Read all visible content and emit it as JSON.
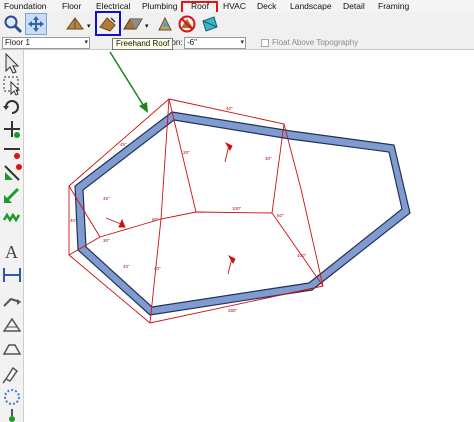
{
  "menu": [
    {
      "key": "foundation",
      "label": "Foundation"
    },
    {
      "key": "floor",
      "label": "Floor"
    },
    {
      "key": "electrical",
      "label": "Electrical"
    },
    {
      "key": "plumbing",
      "label": "Plumbing"
    },
    {
      "key": "roof",
      "label": "Roof"
    },
    {
      "key": "hvac",
      "label": "HVAC"
    },
    {
      "key": "deck",
      "label": "Deck"
    },
    {
      "key": "landscape",
      "label": "Landscape"
    },
    {
      "key": "detail",
      "label": "Detail"
    },
    {
      "key": "framing",
      "label": "Framing"
    }
  ],
  "options": {
    "floor_select": "Floor 1",
    "elevation_label": "ation:",
    "elevation_value": "-6\"",
    "float_label": "Float Above Topography"
  },
  "tooltip": "Freehand Roof",
  "toolbar_icons": [
    "magnifier-icon",
    "pan-icon",
    "roof-icon",
    "freehand-roof-icon",
    "roof-panel-icon",
    "skylight-icon",
    "no-symbol-icon",
    "roof-plane-icon"
  ],
  "palette_icons": [
    "select-arrow-icon",
    "select-area-icon",
    "rotate-icon",
    "move-icon",
    "point-tool-icon",
    "edit-point-icon",
    "add-point-icon",
    "delete-point-icon",
    "pattern-icon",
    "text-icon",
    "dimension-icon",
    "arc-icon",
    "gable-icon",
    "hip-icon",
    "dormer-icon",
    "eye-dropper-icon",
    "circle-dots-icon",
    "snap-icon",
    "end-icon"
  ],
  "colors": {
    "wall_fill": "#7f9bd0",
    "wall_stroke": "#223355",
    "roof_lines": "#cc1111",
    "menu_highlight": "#dd1111",
    "icon_highlight": "#1010cc",
    "arrow": "#1a8a1a"
  },
  "roof_labels": [
    "40\"",
    "45\"",
    "20\"",
    "30\"",
    "45\"",
    "60\"",
    "100\"",
    "50\"",
    "40\"",
    "30\"",
    "40\"",
    "40\"",
    "100\"",
    "280\""
  ]
}
